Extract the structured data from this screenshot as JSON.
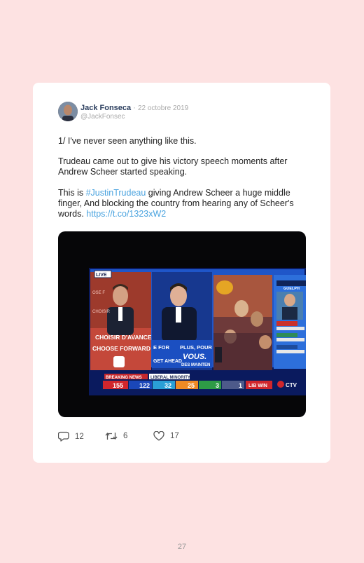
{
  "tweet": {
    "author_name": "Jack Fonseca",
    "separator": "·",
    "date": "22 octobre 2019",
    "handle": "@JackFonsec",
    "paragraph1": "1/ I've never seen anything like this.",
    "paragraph2": "Trudeau came out to give his victory speech moments after Andrew Scheer started speaking.",
    "p3_prefix": "This is ",
    "p3_hashtag": "#JustinTrudeau",
    "p3_middle": " giving Andrew Scheer a huge middle finger, And blocking the country from hearing any of Scheer's words. ",
    "p3_link": "https://t.co/1323xW2"
  },
  "media": {
    "live_badge": "LIVE",
    "banner_left_1": "CHOISIR D'AVANCER",
    "banner_left_2": "CHOOSE FORWARD",
    "podium_line1": "E FOR",
    "podium_line2": "GET AHEAD",
    "podium_right1": "PLUS, POUR",
    "podium_right2": "VOUS.",
    "podium_right3": "DES MAINTEN",
    "side_riding": "GUELPH",
    "breaking_news": "BREAKING NEWS",
    "liberal_minority": "LIBERAL MINORITY",
    "ticker": {
      "lib": "155",
      "con": "122",
      "bq": "32",
      "ndp": "25",
      "grn": "3",
      "ind": "1",
      "lib_win": "LIB WIN"
    },
    "network": "CTV"
  },
  "actions": {
    "replies": "12",
    "retweets": "6",
    "likes": "17"
  },
  "page_number": "27",
  "colors": {
    "background": "#fde2e2",
    "link": "#4aa3df",
    "name": "#2b3e5e"
  },
  "icons": [
    "reply-icon",
    "retweet-icon",
    "like-icon"
  ]
}
